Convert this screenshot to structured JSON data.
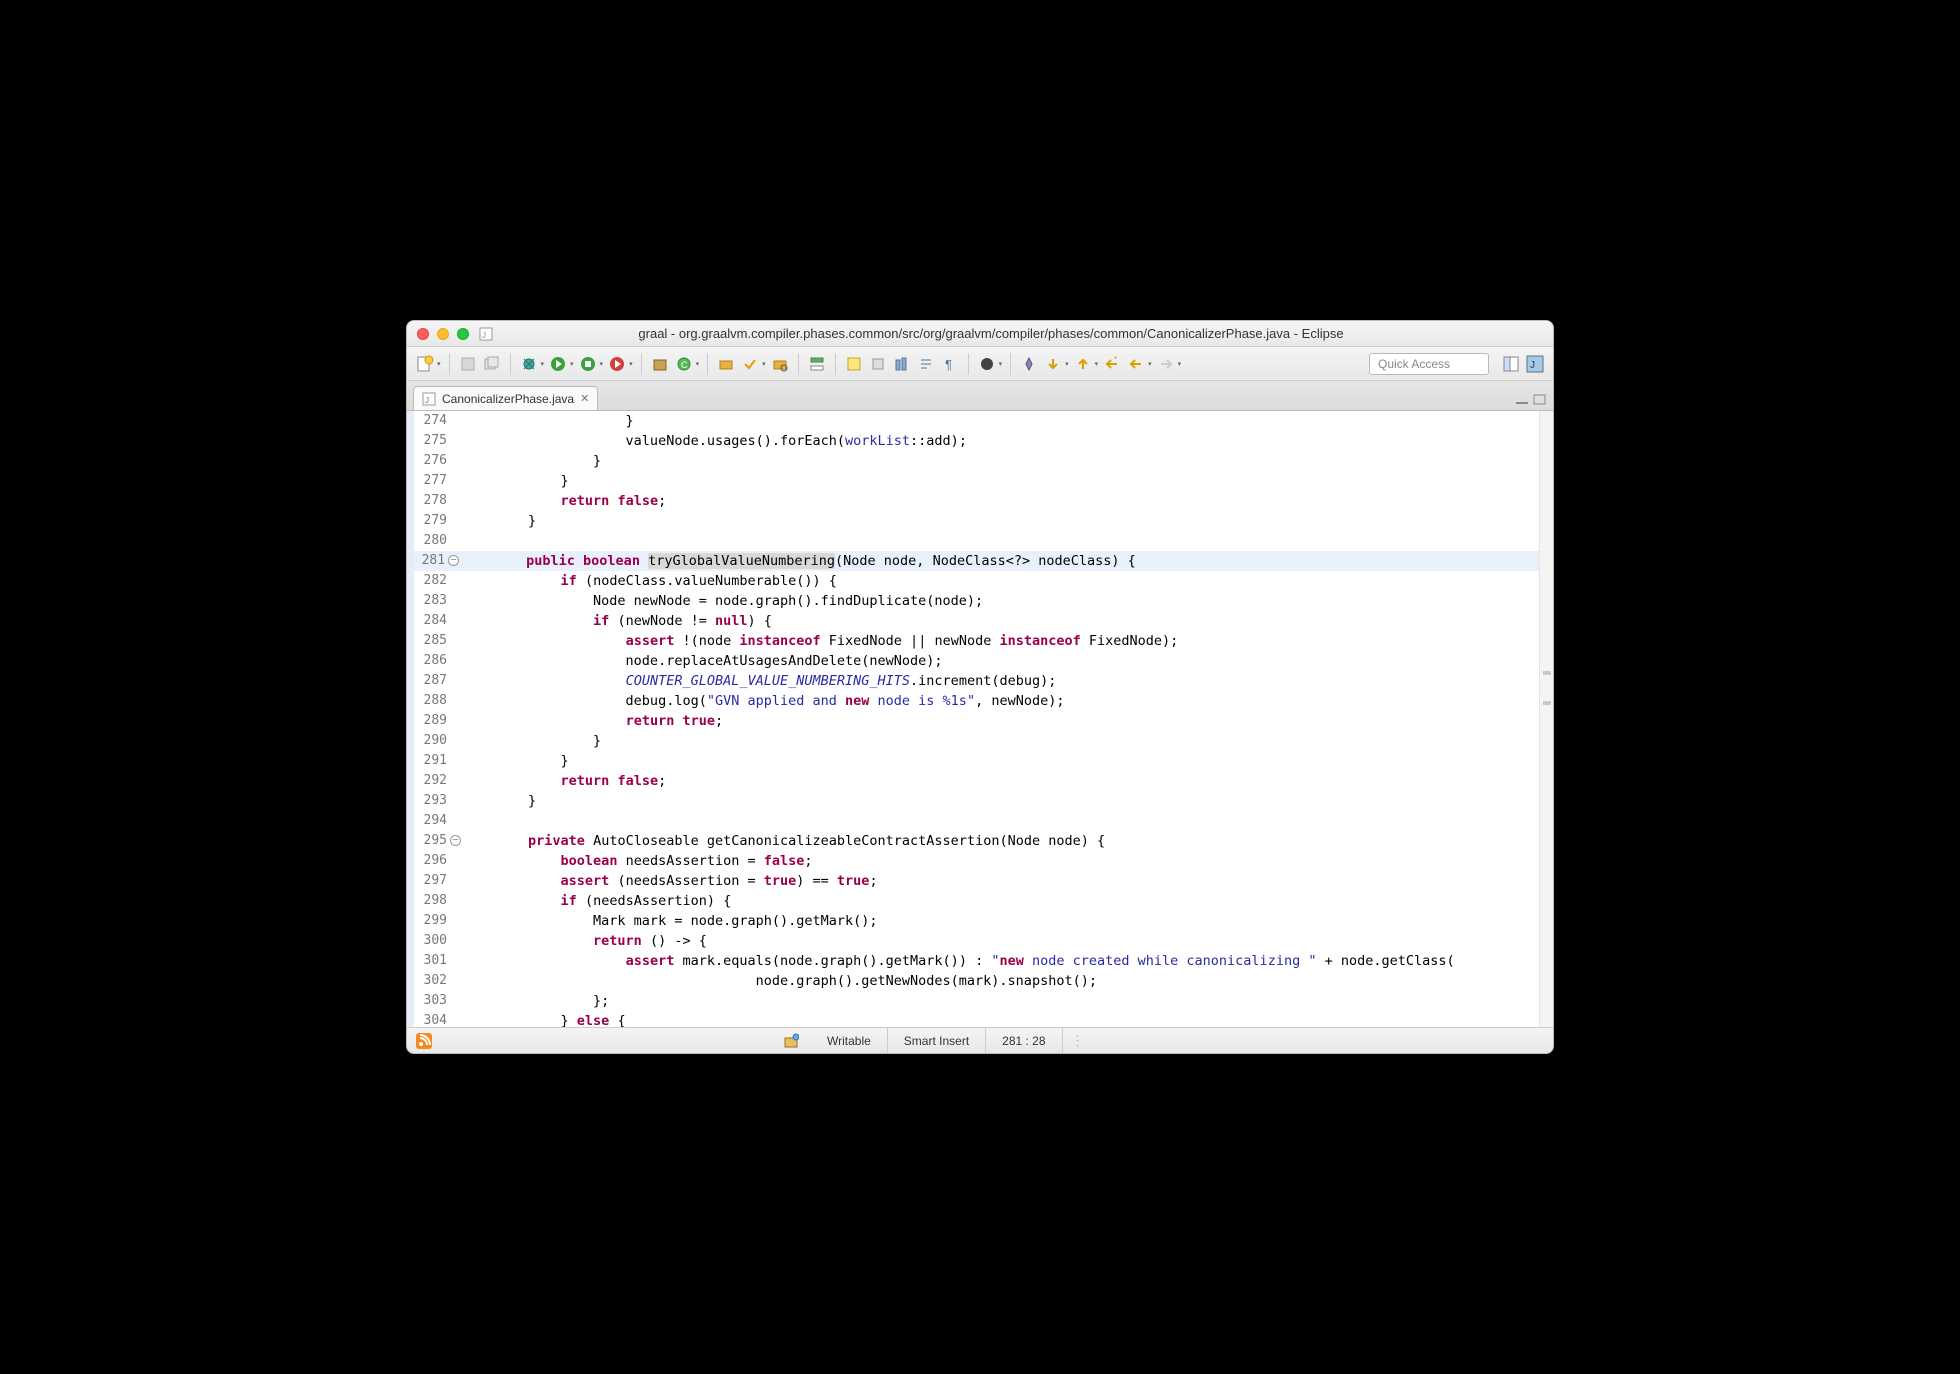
{
  "title": "graal - org.graalvm.compiler.phases.common/src/org/graalvm/compiler/phases/common/CanonicalizerPhase.java - Eclipse",
  "tab": {
    "label": "CanonicalizerPhase.java"
  },
  "quickAccess": {
    "placeholder": "Quick Access"
  },
  "status": {
    "writable": "Writable",
    "insertMode": "Smart Insert",
    "position": "281 : 28"
  },
  "lines": [
    {
      "n": "274",
      "t": "                    }"
    },
    {
      "n": "275",
      "t": "                    valueNode.usages().forEach(workList::add);"
    },
    {
      "n": "276",
      "t": "                }"
    },
    {
      "n": "277",
      "t": "            }"
    },
    {
      "n": "278",
      "t": "            return false;"
    },
    {
      "n": "279",
      "t": "        }"
    },
    {
      "n": "280",
      "t": ""
    },
    {
      "n": "281",
      "t": "        public boolean tryGlobalValueNumbering(Node node, NodeClass<?> nodeClass) {",
      "hl": true,
      "fold": true
    },
    {
      "n": "282",
      "t": "            if (nodeClass.valueNumberable()) {"
    },
    {
      "n": "283",
      "t": "                Node newNode = node.graph().findDuplicate(node);"
    },
    {
      "n": "284",
      "t": "                if (newNode != null) {"
    },
    {
      "n": "285",
      "t": "                    assert !(node instanceof FixedNode || newNode instanceof FixedNode);"
    },
    {
      "n": "286",
      "t": "                    node.replaceAtUsagesAndDelete(newNode);"
    },
    {
      "n": "287",
      "t": "                    COUNTER_GLOBAL_VALUE_NUMBERING_HITS.increment(debug);"
    },
    {
      "n": "288",
      "t": "                    debug.log(\"GVN applied and new node is %1s\", newNode);"
    },
    {
      "n": "289",
      "t": "                    return true;"
    },
    {
      "n": "290",
      "t": "                }"
    },
    {
      "n": "291",
      "t": "            }"
    },
    {
      "n": "292",
      "t": "            return false;"
    },
    {
      "n": "293",
      "t": "        }"
    },
    {
      "n": "294",
      "t": ""
    },
    {
      "n": "295",
      "t": "        private AutoCloseable getCanonicalizeableContractAssertion(Node node) {",
      "fold": true
    },
    {
      "n": "296",
      "t": "            boolean needsAssertion = false;"
    },
    {
      "n": "297",
      "t": "            assert (needsAssertion = true) == true;"
    },
    {
      "n": "298",
      "t": "            if (needsAssertion) {"
    },
    {
      "n": "299",
      "t": "                Mark mark = node.graph().getMark();"
    },
    {
      "n": "300",
      "t": "                return () -> {"
    },
    {
      "n": "301",
      "t": "                    assert mark.equals(node.graph().getMark()) : \"new node created while canonicalizing \" + node.getClass("
    },
    {
      "n": "302",
      "t": "                                    node.graph().getNewNodes(mark).snapshot();"
    },
    {
      "n": "303",
      "t": "                };"
    },
    {
      "n": "304",
      "t": "            } else {"
    }
  ]
}
